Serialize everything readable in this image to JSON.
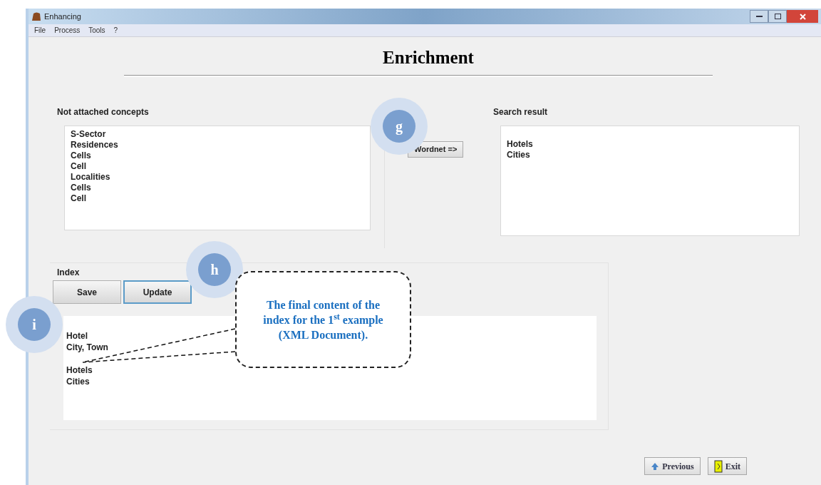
{
  "window": {
    "title": "Enhancing"
  },
  "menu": [
    "File",
    "Process",
    "Tools",
    "?"
  ],
  "heading": "Enrichment",
  "not_attached": {
    "label": "Not attached concepts",
    "items": [
      "S-Sector",
      "Residences",
      "Cells",
      "Cell",
      "Localities",
      "Cells",
      "Cell"
    ]
  },
  "wordnet_button": "Wordnet =>",
  "search_result": {
    "label": "Search result",
    "items": [
      "Hotels",
      "Cities"
    ]
  },
  "index": {
    "label": "Index",
    "buttons": [
      {
        "label": "Save",
        "focused": false
      },
      {
        "label": "Update",
        "focused": true
      }
    ],
    "groups": [
      [
        "Hotel",
        "City, Town"
      ],
      [
        "Hotels",
        "Cities"
      ]
    ]
  },
  "footer_buttons": [
    {
      "label": "Previous",
      "kind": "previous"
    },
    {
      "label": "Exit",
      "kind": "exit"
    }
  ],
  "annotations": {
    "markers": [
      {
        "label": "g"
      },
      {
        "label": "h"
      },
      {
        "label": "i"
      }
    ],
    "callout": "The final content of the index for the 1$^{st}$ example (XML Document)."
  }
}
